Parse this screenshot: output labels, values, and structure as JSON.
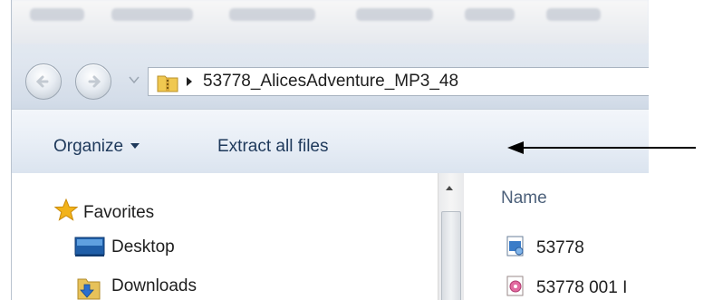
{
  "address_bar": {
    "path": "53778_AlicesAdventure_MP3_48"
  },
  "command_bar": {
    "organize_label": "Organize",
    "extract_label": "Extract all files"
  },
  "navigation_pane": {
    "favorites_label": "Favorites",
    "items": [
      {
        "label": "Desktop",
        "icon": "desktop-icon"
      },
      {
        "label": "Downloads",
        "icon": "downloads-folder-icon"
      }
    ]
  },
  "file_list": {
    "column_name": "Name",
    "files": [
      {
        "label": "53778",
        "icon": "playlist-icon"
      },
      {
        "label": "53778 001 I",
        "icon": "audio-file-icon"
      }
    ]
  },
  "colors": {
    "command_text": "#1e395b",
    "column_header": "#4c607a",
    "favorites_star": "#f2b31a"
  }
}
